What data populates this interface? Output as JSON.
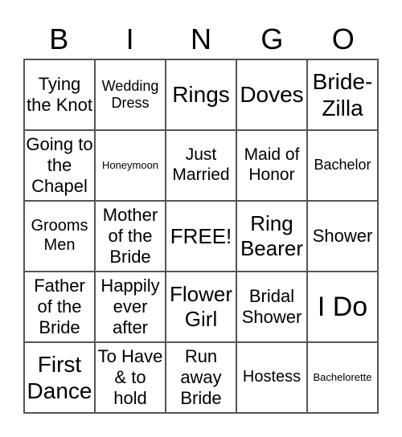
{
  "header": [
    "B",
    "I",
    "N",
    "G",
    "O"
  ],
  "cells": [
    "Tying the Knot",
    "Wedding Dress",
    "Rings",
    "Doves",
    "Bride-Zilla",
    "Going to the Chapel",
    "Honeymoon",
    "Just Married",
    "Maid of Honor",
    "Bachelor",
    "Grooms Men",
    "Mother of the Bride",
    "FREE!",
    "Ring Bearer",
    "Shower",
    "Father of the Bride",
    "Happily ever after",
    "Flower Girl",
    "Bridal Shower",
    "I Do",
    "First Dance",
    "To Have & to hold",
    "Run away Bride",
    "Hostess",
    "Bachelorette"
  ]
}
